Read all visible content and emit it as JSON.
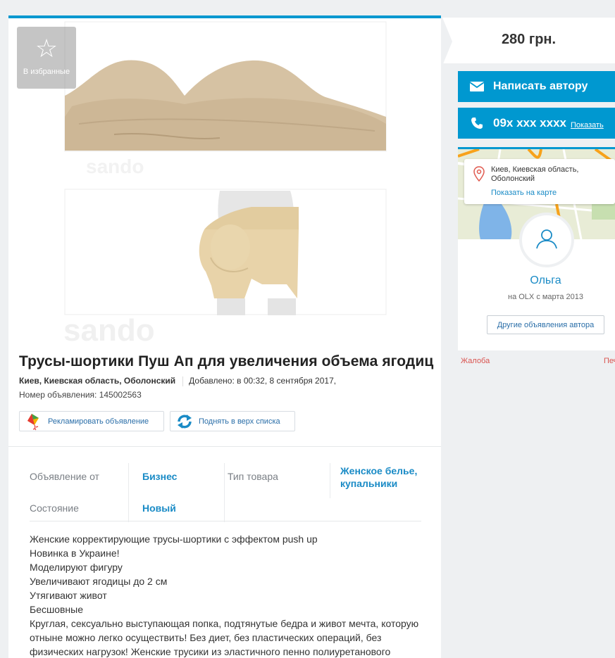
{
  "favorite": {
    "label": "В избранные",
    "icon": "star-outline-icon"
  },
  "listing": {
    "title": "Трусы-шортики Пуш Ап для увеличения объема ягодиц",
    "location": "Киев, Киевская область, Оболонский",
    "added": "Добавлено: в 00:32, 8 сентября 2017,",
    "ad_number": "Номер объявления: 145002563",
    "watermark": "sando"
  },
  "promo": {
    "advertise_label": "Рекламировать объявление",
    "raise_label": "Поднять в верх списка"
  },
  "attributes": [
    {
      "label": "Объявление от",
      "value": "Бизнес"
    },
    {
      "label": "Тип товара",
      "value_line1": "Женское белье,",
      "value_line2": "купальники"
    },
    {
      "label": "Состояние",
      "value": "Новый"
    }
  ],
  "description": [
    "Женские корректирующие трусы-шортики с эффектом push up",
    "Новинка в Украине!",
    "Моделируют фигуру",
    "Увеличивают ягодицы до 2 см",
    "Утягивают живот",
    "Бесшовные",
    "Круглая, сексуально выступающая попка, подтянутые бедра и живот мечта, которую",
    "отныне можно легко осуществить! Без диет, без пластических операций, без",
    "физических нагрузок! Женские трусики из эластичного пенно полиуретанового"
  ],
  "sidebar": {
    "price": "280 грн.",
    "write_label": "Написать автору",
    "phone": "09x xxx xxxx",
    "show_label": "Показать",
    "location_line1": "Киев, Киевская область,",
    "location_line2": "Оболонский",
    "map_link": "Показать на карте",
    "seller_name": "Ольга",
    "since": "на OLX с марта 2013",
    "other_ads": "Другие объявления автора",
    "complaint": "Жалоба",
    "print": "Печ"
  },
  "colors": {
    "accent": "#0098d0",
    "link": "#1a8bc6",
    "complaint": "#d9534f"
  }
}
